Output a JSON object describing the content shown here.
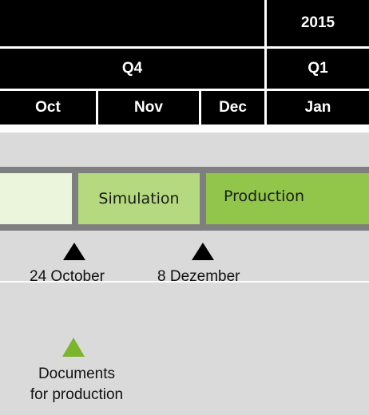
{
  "header": {
    "year": "2015",
    "quarters": {
      "q4": "Q4",
      "q1": "Q1"
    },
    "months": [
      "Oct",
      "Nov",
      "Dec",
      "Jan"
    ]
  },
  "phases": {
    "phase1": "",
    "phase2": "Simulation",
    "phase3": "Production"
  },
  "milestones": [
    {
      "label": "24 October",
      "color": "#000000"
    },
    {
      "label": "8 Dezember",
      "color": "#000000"
    }
  ],
  "deliverable": {
    "line1": "Documents",
    "line2": "for production",
    "color": "#7ab52b"
  },
  "colors": {
    "header_bg": "#000000",
    "header_text": "#ffffff",
    "phase1": "#eaf5dc",
    "phase2": "#b5d97e",
    "phase3": "#92c64a",
    "frame": "#7f7f7f",
    "background": "#dadada"
  }
}
